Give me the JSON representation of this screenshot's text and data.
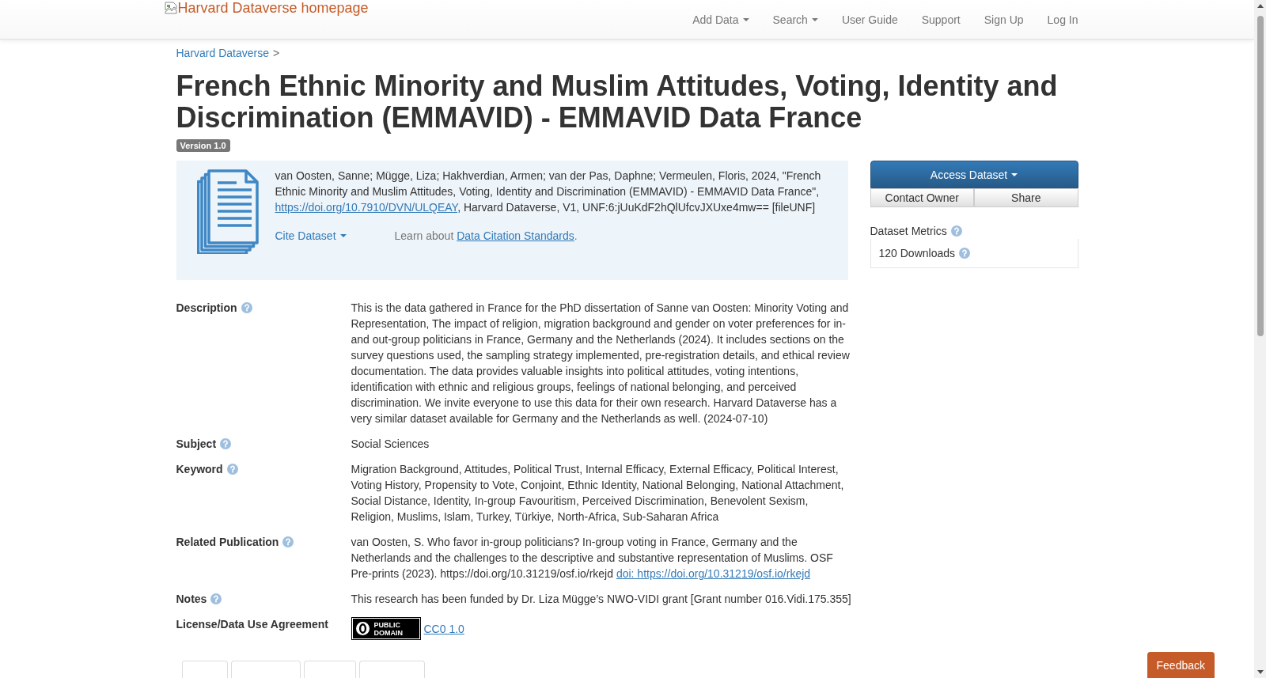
{
  "navbar": {
    "logo_alt": "Harvard Dataverse homepage",
    "items": [
      {
        "label": "Add Data",
        "dropdown": true
      },
      {
        "label": "Search",
        "dropdown": true
      },
      {
        "label": "User Guide",
        "dropdown": false
      },
      {
        "label": "Support",
        "dropdown": false
      },
      {
        "label": "Sign Up",
        "dropdown": false
      },
      {
        "label": "Log In",
        "dropdown": false
      }
    ]
  },
  "breadcrumb": {
    "items": [
      "Harvard Dataverse"
    ],
    "separator": ">"
  },
  "title": "French Ethnic Minority and Muslim Attitudes, Voting, Identity and Discrimination (EMMAVID) - EMMAVID Data France",
  "version": "Version 1.0",
  "citation": {
    "text_before": "van Oosten, Sanne; Mügge, Liza; Hakhverdian, Armen; van der Pas, Daphne; Vermeulen, Floris, 2024, \"French Ethnic Minority and Muslim Attitudes, Voting, Identity and Discrimination (EMMAVID) - EMMAVID Data France\",",
    "link": "https://doi.org/10.7910/DVN/ULQEAY",
    "text_after": ", Harvard Dataverse, V1, UNF:6:jUuKdF2hQlUfcvJXUxe4mw== [fileUNF]",
    "cite_button": {
      "label": "Cite Dataset",
      "dropdown": true
    },
    "learn": {
      "before": "Learn about",
      "link": "Data Citation Standards",
      "after": "."
    }
  },
  "actions": {
    "primary": {
      "label": "Access Dataset",
      "dropdown": true
    },
    "secondary": [
      "Contact Owner",
      "Share"
    ]
  },
  "metrics": {
    "title": "Dataset Metrics",
    "help": true,
    "items": [
      {
        "label": "120 Downloads",
        "help": true
      }
    ]
  },
  "fields": [
    {
      "label": "Description",
      "help": true,
      "kind": "text",
      "value": "This is the data gathered in France for the PhD dissertation of Sanne van Oosten: Minority Voting and Representation, The impact of religion, migration background and gender on voter preferences for in- and out-group politicians in France, Germany and the Netherlands (2024). It includes sections on the survey questions used, the sampling strategy implemented, pre-registration details, and ethical review documentation. The data provides valuable insights into political attitudes, voting intentions, identification with ethnic and religious groups, feelings of national belonging, and perceived discrimination. We invite everyone to use this data for their own research. Harvard Dataverse has a very similar dataset available for Germany and the Netherlands as well. (2024-07-10)"
    },
    {
      "label": "Subject",
      "help": true,
      "kind": "text",
      "value": "Social Sciences"
    },
    {
      "label": "Keyword",
      "help": true,
      "kind": "text",
      "value": "Migration Background, Attitudes, Political Trust, Internal Efficacy, External Efficacy, Political Interest, Voting History, Propensity to Vote, Conjoint, Ethnic Identity, National Belonging, National Attachment, Social Distance, Identity, In-group Favouritism, Perceived Discrimination, Benevolent Sexism, Religion, Muslims, Islam, Turkey, Türkiye, North-Africa, Sub-Saharan Africa"
    },
    {
      "label": "Related Publication",
      "help": true,
      "kind": "text_link",
      "value": "van Oosten, S. Who favor in-group politicians? In-group voting in France, Germany and the Netherlands and the challenges to the descriptive and substantive representation of Muslims. OSF Pre-prints (2023). https://doi.org/10.31219/osf.io/rkejd",
      "link": "doi: https://doi.org/10.31219/osf.io/rkejd"
    },
    {
      "label": "Notes",
      "help": true,
      "kind": "text",
      "value": "This research has been funded by Dr. Liza Mügge’s NWO-VIDI grant [Grant number 016.Vidi.175.355]"
    },
    {
      "label": "License/Data Use Agreement",
      "help": false,
      "kind": "license",
      "badge": [
        "PUBLIC",
        "DOMAIN"
      ],
      "link": "CC0 1.0"
    }
  ],
  "feedback_button": "Feedback"
}
